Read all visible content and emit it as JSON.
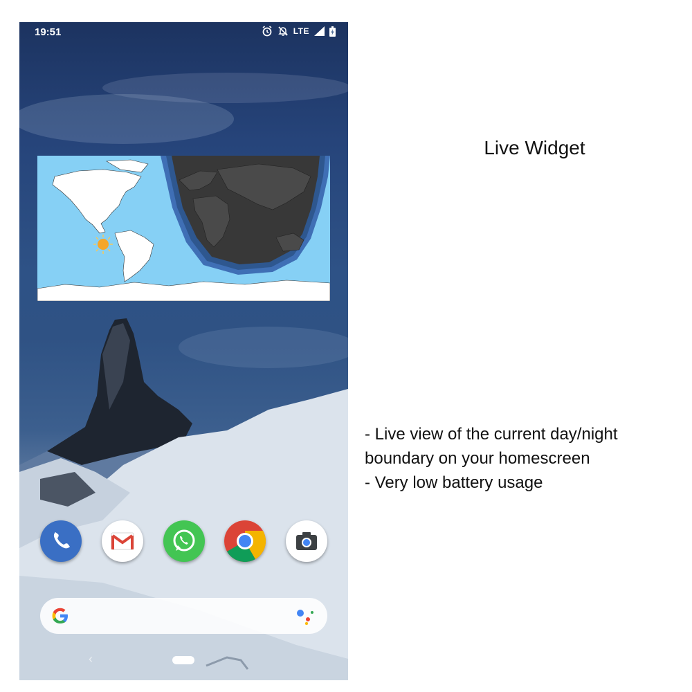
{
  "status_bar": {
    "time": "19:51",
    "network": "LTE",
    "icons": [
      "alarm-icon",
      "notifications-off-icon",
      "signal-icon",
      "battery-charging-icon"
    ]
  },
  "widget": {
    "description_icons": [
      "world-map",
      "sun-icon",
      "night-shadow"
    ],
    "colors": {
      "ocean": "#86d0f5",
      "land": "#ffffff",
      "night": "#383838",
      "twilight": "#3f6fb5"
    }
  },
  "dock": {
    "apps": [
      {
        "name": "Phone",
        "icon": "phone-icon",
        "color": "#3a6fc4"
      },
      {
        "name": "Gmail",
        "icon": "gmail-icon",
        "color": "#ffffff"
      },
      {
        "name": "WhatsApp",
        "icon": "whatsapp-icon",
        "color": "#43c553"
      },
      {
        "name": "Chrome",
        "icon": "chrome-icon",
        "color": "#ffffff"
      },
      {
        "name": "Camera",
        "icon": "camera-icon",
        "color": "#ffffff"
      }
    ]
  },
  "search": {
    "icon_left": "google-g-icon",
    "icon_right": "assistant-icon"
  },
  "nav": {
    "back": "‹"
  },
  "promo": {
    "heading": "Live Widget",
    "features": [
      "- Live view of the current day/night",
      "boundary on your homescreen",
      "- Very low battery usage"
    ]
  }
}
